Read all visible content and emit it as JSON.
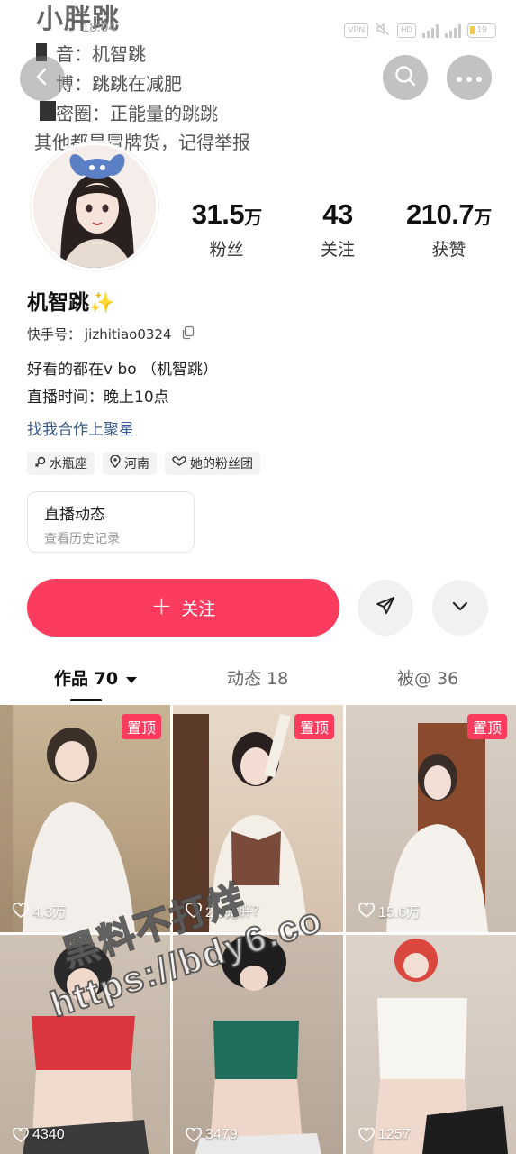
{
  "status_bar": {
    "time": "18:04",
    "vpn": "VPN",
    "hd": "HD",
    "network1": "4G",
    "network2": "4G",
    "battery": "19"
  },
  "background_bio": {
    "title": "小胖跳",
    "lines": [
      "音：机智跳",
      "博：跳跳在减肥",
      "密圈：正能量的跳跳",
      "其他都是冒牌货，记得举报"
    ]
  },
  "header": {
    "back_icon": "chevron-left-icon",
    "search_icon": "search-icon",
    "more_icon": "more-dots-icon"
  },
  "stats": [
    {
      "number": "31.5",
      "unit": "万",
      "label": "粉丝"
    },
    {
      "number": "43",
      "unit": "",
      "label": "关注"
    },
    {
      "number": "210.7",
      "unit": "万",
      "label": "获赞"
    }
  ],
  "profile": {
    "nickname": "机智跳✨",
    "uid_label": "快手号：",
    "uid_value": "jizhitiao0324",
    "bio_line1": "好看的都在v bo （机智跳）",
    "bio_line2": "直播时间：晚上10点",
    "collab_link": "找我合作上聚星"
  },
  "tags": [
    {
      "icon": "gender-female-icon",
      "label": "水瓶座"
    },
    {
      "icon": "location-pin-icon",
      "label": "河南"
    },
    {
      "icon": "fan-group-icon",
      "label": "她的粉丝团"
    }
  ],
  "live_card": {
    "title": "直播动态",
    "subtitle": "查看历史记录"
  },
  "actions": {
    "follow_label": "关注",
    "share_icon": "send-icon",
    "expand_icon": "chevron-down-icon"
  },
  "tabs": [
    {
      "label": "作品 70",
      "active": true
    },
    {
      "label": "动态 18",
      "active": false
    },
    {
      "label": "被@ 36",
      "active": false
    }
  ],
  "videos": [
    {
      "pinned": true,
      "pin_label": "置顶",
      "likes": "4.3万",
      "caption": ""
    },
    {
      "pinned": true,
      "pin_label": "置顶",
      "likes": "2.9万",
      "caption": "猪胖?"
    },
    {
      "pinned": true,
      "pin_label": "置顶",
      "likes": "15.6万",
      "caption": ""
    },
    {
      "pinned": false,
      "pin_label": "",
      "likes": "4340",
      "caption": ""
    },
    {
      "pinned": false,
      "pin_label": "",
      "likes": "3479",
      "caption": ""
    },
    {
      "pinned": false,
      "pin_label": "",
      "likes": "1257",
      "caption": ""
    }
  ],
  "watermark": {
    "line1": "黑料不打烊",
    "line2": "https://bdy6.co"
  },
  "colors": {
    "accent": "#fb3c5f",
    "link": "#3a5a8c"
  }
}
